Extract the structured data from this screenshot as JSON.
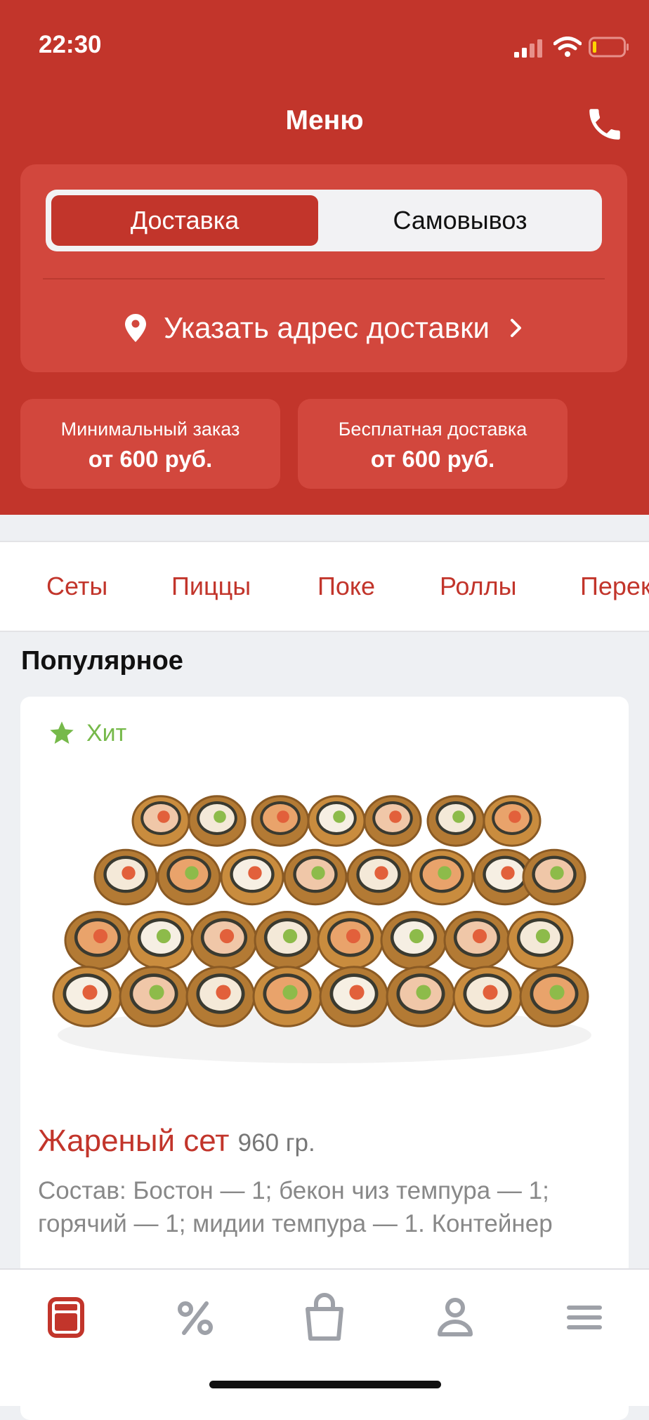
{
  "status": {
    "time": "22:30"
  },
  "header": {
    "title": "Меню",
    "phone_icon": "phone-icon"
  },
  "delivery": {
    "tabs": [
      "Доставка",
      "Самовывоз"
    ],
    "active_tab": "Доставка",
    "address_label": "Указать адрес доставки"
  },
  "info_cards": [
    {
      "label": "Минимальный заказ",
      "value": "от 600 руб."
    },
    {
      "label": "Бесплатная доставка",
      "value": "от 600 руб."
    }
  ],
  "categories": [
    "Сеты",
    "Пиццы",
    "Поке",
    "Роллы",
    "Перек"
  ],
  "section_title": "Популярное",
  "product": {
    "badge": "Хит",
    "name": "Жареный сет",
    "weight": "960 гр.",
    "description": "Состав: Бостон — 1; бекон чиз темпура — 1; горячий — 1; мидии темпура — 1. Контейнер"
  },
  "bottom_nav": [
    {
      "name": "menu",
      "icon": "menu-card-icon",
      "active": true
    },
    {
      "name": "promotions",
      "icon": "percent-icon",
      "active": false
    },
    {
      "name": "cart",
      "icon": "shopping-bag-icon",
      "active": false
    },
    {
      "name": "profile",
      "icon": "user-icon",
      "active": false
    },
    {
      "name": "more",
      "icon": "hamburger-icon",
      "active": false
    }
  ],
  "colors": {
    "brand": "#c2352b",
    "card": "#d2473d",
    "badge": "#76b94a",
    "inactive_icon": "#9ea1a8"
  }
}
